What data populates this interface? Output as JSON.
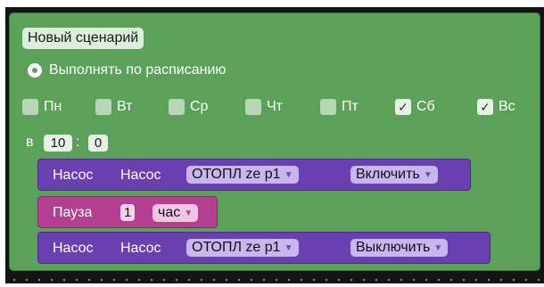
{
  "scenario": {
    "name": "Новый сценарий",
    "schedule_label": "Выполнять по расписанию",
    "days": [
      {
        "label": "Пн",
        "checked": false
      },
      {
        "label": "Вт",
        "checked": false
      },
      {
        "label": "Ср",
        "checked": false
      },
      {
        "label": "Чт",
        "checked": false
      },
      {
        "label": "Пт",
        "checked": false
      },
      {
        "label": "Сб",
        "checked": true
      },
      {
        "label": "Вс",
        "checked": true
      }
    ],
    "time_prefix": "в",
    "hour": "10",
    "time_separator": ":",
    "minute": "0"
  },
  "actions": [
    {
      "type": "pump",
      "label1": "Насос",
      "label2": "Насос",
      "device": "ОТОПЛ ze p1",
      "command": "Включить"
    },
    {
      "type": "pause",
      "label": "Пауза",
      "amount": "1",
      "unit": "час"
    },
    {
      "type": "pump",
      "label1": "Насос",
      "label2": "Насос",
      "device": "ОТОПЛ ze p1",
      "command": "Выключить"
    }
  ],
  "icons": {
    "checkmark": "✓",
    "dropdown_arrow": "▼"
  },
  "colors": {
    "workspace": "#141414",
    "scenario_block": "#5ba15a",
    "pump_block": "#6a3fb0",
    "pause_block": "#b23f8f"
  }
}
